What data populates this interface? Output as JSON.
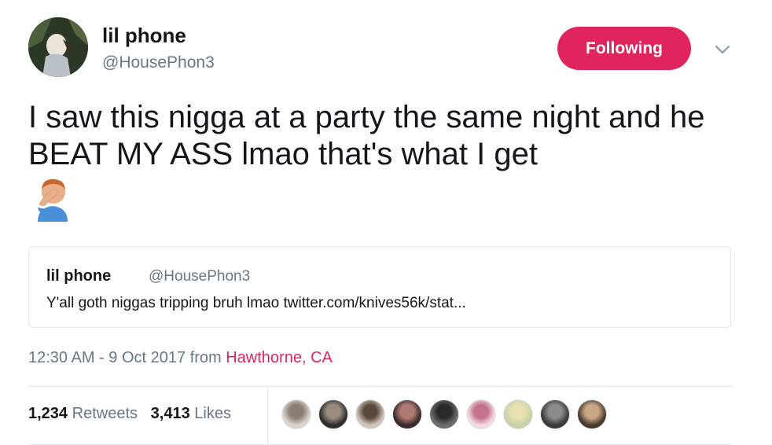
{
  "header": {
    "display_name": "lil phone",
    "handle": "@HousePhon3",
    "follow_button_label": "Following"
  },
  "tweet": {
    "text": "I saw this nigga at a party the same night and he BEAT MY ASS lmao that's what I get"
  },
  "quoted_tweet": {
    "display_name": "lil phone",
    "handle": "@HousePhon3",
    "text": "Y'all goth niggas tripping bruh lmao twitter.com/knives56k/stat..."
  },
  "meta": {
    "time_date": "12:30 AM - 9 Oct 2017 from ",
    "place": "Hawthorne, CA"
  },
  "stats": {
    "retweets_count": "1,234",
    "retweets_label": "Retweets",
    "likes_count": "3,413",
    "likes_label": "Likes"
  },
  "colors": {
    "accent": "#e0245e",
    "secondary_text": "#657786",
    "border": "#e1e8ed"
  },
  "icons": [
    "chevron-down-icon",
    "facepalm-emoji"
  ],
  "liker_avatars": [
    {
      "color_a": "#d9d4cf",
      "color_b": "#8c7e72"
    },
    {
      "color_a": "#2f2f2f",
      "color_b": "#9a8d7f"
    },
    {
      "color_a": "#cfc5b8",
      "color_b": "#5a4a3d"
    },
    {
      "color_a": "#3a2b2b",
      "color_b": "#b07a72"
    },
    {
      "color_a": "#6d6d6d",
      "color_b": "#2a2a2a"
    },
    {
      "color_a": "#f4d9e0",
      "color_b": "#c3748a"
    },
    {
      "color_a": "#c8d2a8",
      "color_b": "#e7e0b3"
    },
    {
      "color_a": "#3d3a3a",
      "color_b": "#8c8c8c"
    },
    {
      "color_a": "#4a3b2f",
      "color_b": "#c9a985"
    }
  ]
}
